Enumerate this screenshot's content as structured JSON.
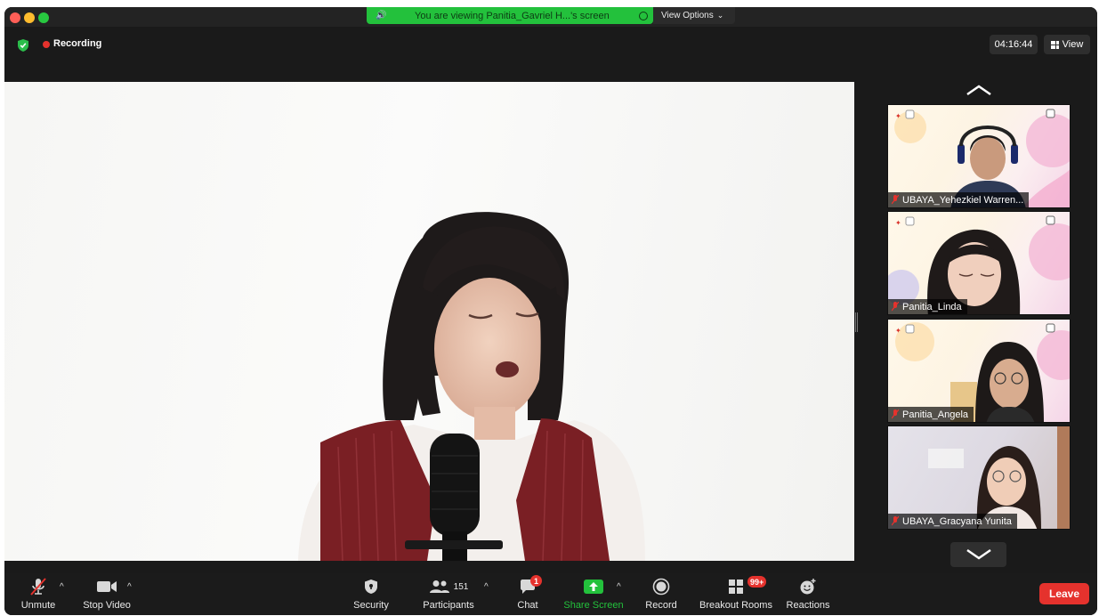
{
  "banner": {
    "sharing_text": "You are viewing Panitia_Gavriel H...'s screen",
    "view_options_label": "View Options"
  },
  "status": {
    "recording_label": "Recording",
    "timer": "04:16:44",
    "view_label": "View"
  },
  "gallery": {
    "participants": [
      {
        "name": "UBAYA_Yehezkiel Warren..."
      },
      {
        "name": "Panitia_Linda"
      },
      {
        "name": "Panitia_Angela"
      },
      {
        "name": "UBAYA_Gracyana Yunita"
      }
    ]
  },
  "toolbar": {
    "unmute": "Unmute",
    "stop_video": "Stop Video",
    "security": "Security",
    "participants": "Participants",
    "participant_count": "151",
    "chat": "Chat",
    "chat_badge": "1",
    "share_screen": "Share Screen",
    "record": "Record",
    "breakout_rooms": "Breakout Rooms",
    "breakout_badge": "99+",
    "reactions": "Reactions",
    "leave": "Leave"
  },
  "colors": {
    "share_green": "#23c13c",
    "recording_red": "#e5322d",
    "leave_red": "#e5322d",
    "toolbar_bg": "#1b1b1b"
  }
}
